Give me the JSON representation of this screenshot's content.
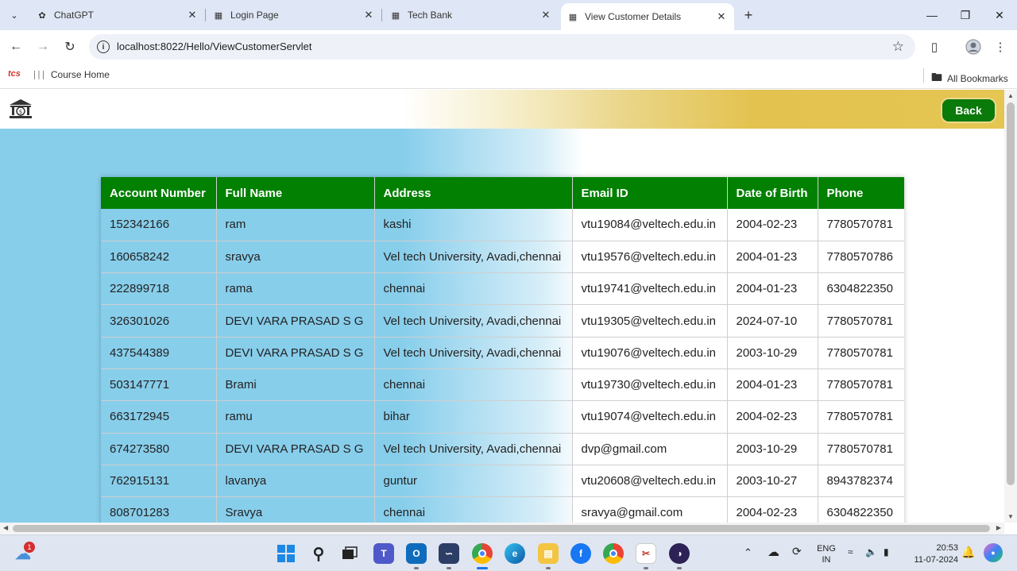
{
  "browser": {
    "tabs": [
      {
        "title": "ChatGPT",
        "favicon": "chatgpt-icon"
      },
      {
        "title": "Login Page",
        "favicon": "page-icon"
      },
      {
        "title": "Tech Bank",
        "favicon": "page-icon"
      },
      {
        "title": "View Customer Details",
        "favicon": "page-icon",
        "active": true
      }
    ],
    "new_tab_symbol": "+",
    "url": "localhost:8022/Hello/ViewCustomerServlet",
    "bookmarks": [
      {
        "label": "tcs",
        "icon": "tcs-logo"
      },
      {
        "label": "Course Home",
        "icon": "cisco-logo"
      }
    ],
    "all_bookmarks": "All Bookmarks"
  },
  "page": {
    "back_label": "Back",
    "table": {
      "headers": [
        "Account Number",
        "Full Name",
        "Address",
        "Email ID",
        "Date of Birth",
        "Phone"
      ],
      "rows": [
        [
          "152342166",
          "ram",
          "kashi",
          "vtu19084@veltech.edu.in",
          "2004-02-23",
          "7780570781"
        ],
        [
          "160658242",
          "sravya",
          "Vel tech University, Avadi,chennai",
          "vtu19576@veltech.edu.in",
          "2004-01-23",
          "7780570786"
        ],
        [
          "222899718",
          "rama",
          "chennai",
          "vtu19741@veltech.edu.in",
          "2004-01-23",
          "6304822350"
        ],
        [
          "326301026",
          "DEVI VARA PRASAD S G",
          "Vel tech University, Avadi,chennai",
          "vtu19305@veltech.edu.in",
          "2024-07-10",
          "7780570781"
        ],
        [
          "437544389",
          "DEVI VARA PRASAD S G",
          "Vel tech University, Avadi,chennai",
          "vtu19076@veltech.edu.in",
          "2003-10-29",
          "7780570781"
        ],
        [
          "503147771",
          "Brami",
          "chennai",
          "vtu19730@veltech.edu.in",
          "2004-01-23",
          "7780570781"
        ],
        [
          "663172945",
          "ramu",
          "bihar",
          "vtu19074@veltech.edu.in",
          "2004-02-23",
          "7780570781"
        ],
        [
          "674273580",
          "DEVI VARA PRASAD S G",
          "Vel tech University, Avadi,chennai",
          "dvp@gmail.com",
          "2003-10-29",
          "7780570781"
        ],
        [
          "762915131",
          "lavanya",
          "guntur",
          "vtu20608@veltech.edu.in",
          "2003-10-27",
          "8943782374"
        ],
        [
          "808701283",
          "Sravya",
          "chennai",
          "sravya@gmail.com",
          "2004-02-23",
          "6304822350"
        ]
      ]
    },
    "colors": {
      "header_green": "#018001",
      "back_button": "#0a7a0a",
      "sky_blue": "#87ceeb",
      "gold": "#e3c24f"
    }
  },
  "taskbar": {
    "weather_badge": "1",
    "language": "ENG",
    "region": "IN",
    "time": "20:53",
    "date": "11-07-2024"
  }
}
